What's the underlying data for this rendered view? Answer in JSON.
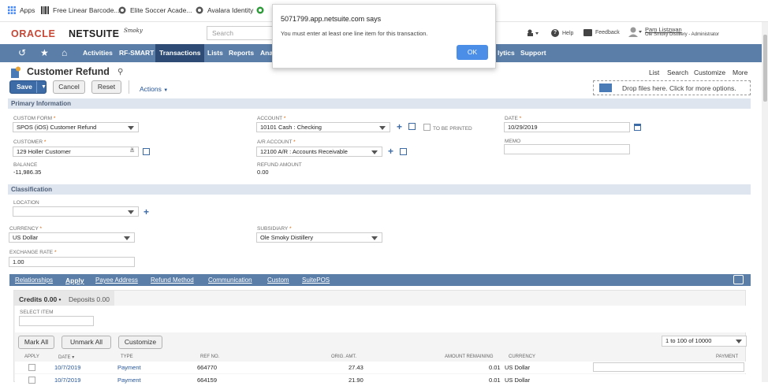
{
  "bookmarks": {
    "apps": "Apps",
    "linear": "Free Linear Barcode...",
    "soccer": "Elite Soccer Acade...",
    "avalara": "Avalara Identity"
  },
  "header": {
    "oracle": "ORACLE",
    "netsuite": "NETSUITE",
    "brand": "Smoky",
    "search_placeholder": "Search",
    "help": "Help",
    "feedback": "Feedback",
    "user_name": "Pam Listzwan",
    "user_role": "Ole Smoky Distillery - Administrator"
  },
  "nav": {
    "activities": "Activities",
    "rfsmart": "RF-SMART",
    "transactions": "Transactions",
    "lists": "Lists",
    "reports": "Reports",
    "analytics_start": "Ana",
    "analytics_end": "lytics",
    "support": "Support"
  },
  "page": {
    "title": "Customer Refund",
    "links": {
      "list": "List",
      "search": "Search",
      "customize": "Customize",
      "more": "More"
    },
    "save": "Save",
    "cancel": "Cancel",
    "reset": "Reset",
    "actions": "Actions",
    "dropzone": "Drop files here. Click for more options."
  },
  "primary": {
    "section": "Primary Information",
    "custom_form_label": "CUSTOM FORM",
    "custom_form": "SPOS (iOS) Customer Refund",
    "account_label": "ACCOUNT",
    "account": "10101 Cash : Checking",
    "to_be_printed": "TO BE PRINTED",
    "date_label": "DATE",
    "date": "10/29/2019",
    "customer_label": "CUSTOMER",
    "customer": "129 Holler Customer",
    "ar_label": "A/R ACCOUNT",
    "ar": "12100 A/R : Accounts Receivable",
    "memo_label": "MEMO",
    "balance_label": "BALANCE",
    "balance": "-11,986.35",
    "refund_label": "REFUND AMOUNT",
    "refund": "0.00"
  },
  "classification": {
    "section": "Classification",
    "location_label": "LOCATION",
    "currency_label": "CURRENCY",
    "currency": "US Dollar",
    "subsidiary_label": "SUBSIDIARY",
    "subsidiary": "Ole Smoky Distillery",
    "exchange_label": "EXCHANGE RATE",
    "exchange": "1.00"
  },
  "subtabs": [
    "Relationships",
    "Apply",
    "Payee Address",
    "Refund Method",
    "Communication",
    "Custom",
    "SuitePOS"
  ],
  "apply": {
    "credits": "Credits 0.00 •",
    "deposits": "Deposits 0.00",
    "select_item": "SELECT ITEM",
    "mark_all": "Mark All",
    "unmark_all": "Unmark All",
    "customize": "Customize",
    "pager": "1 to 100 of 10000",
    "columns": [
      "APPLY",
      "DATE ▾",
      "TYPE",
      "REF NO.",
      "ORIG. AMT.",
      "AMOUNT REMAINING",
      "CURRENCY",
      "PAYMENT"
    ],
    "rows": [
      {
        "date": "10/7/2019",
        "type": "Payment",
        "ref": "664770",
        "orig": "27.43",
        "remaining": "0.01",
        "currency": "US Dollar"
      },
      {
        "date": "10/7/2019",
        "type": "Payment",
        "ref": "664159",
        "orig": "21.90",
        "remaining": "0.01",
        "currency": "US Dollar"
      }
    ]
  },
  "dialog": {
    "title": "5071799.app.netsuite.com says",
    "message": "You must enter at least one line item for this transaction.",
    "ok": "OK"
  },
  "colors": {
    "nav": "#5a7ea8",
    "accent": "#3d6ba6",
    "ok": "#4a8ee8",
    "oracle_red": "#c74634"
  }
}
